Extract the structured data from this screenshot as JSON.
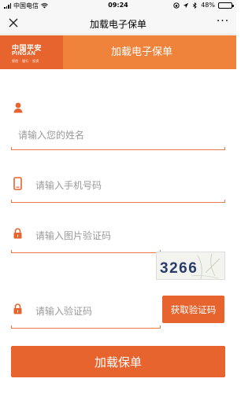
{
  "status_bar": {
    "carrier": "中国电信",
    "time": "09:24",
    "battery": "48%",
    "battery_level": 0.48
  },
  "nav": {
    "title": "加载电子保单",
    "close_icon": "close-icon",
    "more_icon": "more-icon"
  },
  "banner": {
    "logo_cn": "中国平安",
    "logo_en": "PINGAN",
    "logo_slogan": "保险 · 银行 · 投资",
    "heading": "加载电子保单"
  },
  "form": {
    "name": {
      "placeholder": "请输入您的姓名",
      "icon": "user-icon"
    },
    "phone": {
      "placeholder": "请输入手机号码",
      "icon": "phone-icon"
    },
    "image_code": {
      "placeholder": "请输入图片验证码",
      "icon": "lock-icon",
      "captcha_text": "3266"
    },
    "sms_code": {
      "placeholder": "请输入验证码",
      "icon": "lock-icon",
      "button_label": "获取验证码"
    },
    "submit_label": "加载保单"
  },
  "colors": {
    "accent": "#e8642e",
    "banner_right": "#f0833c"
  }
}
